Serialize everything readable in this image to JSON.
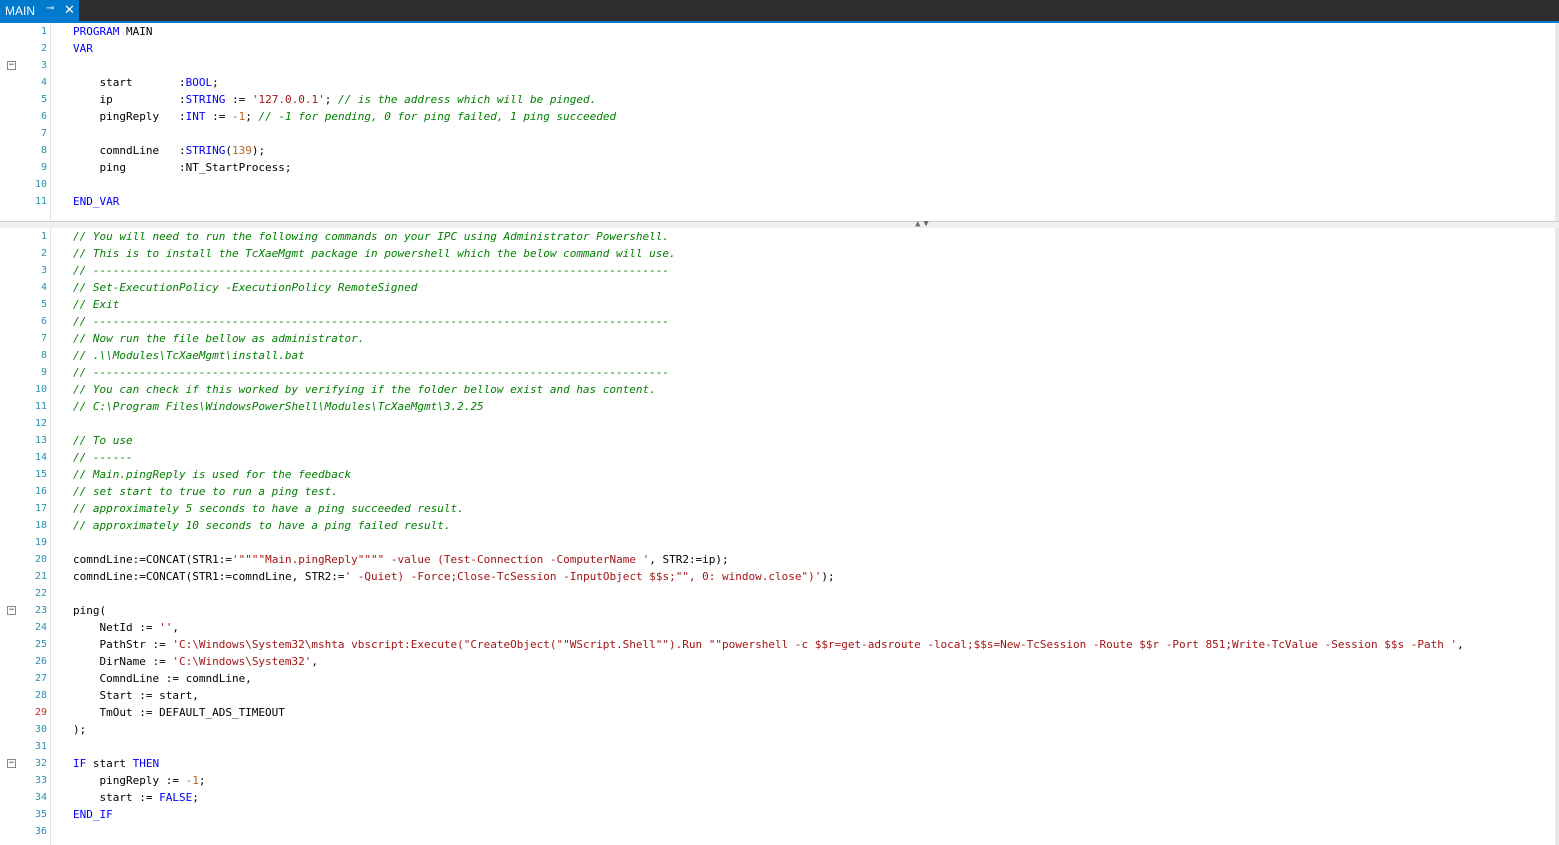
{
  "tab": {
    "title": "MAIN",
    "pin_icon": "⊸",
    "close_icon": "✕"
  },
  "colors": {
    "tab_active": "#007acc",
    "tab_bar": "#2d2d30",
    "keyword": "#0000ff",
    "string": "#a31515",
    "comment": "#008000",
    "line_number": "#2b91af",
    "breakpoint_line": "#c42b1c"
  },
  "declaration_pane": {
    "fold_icon": "⊟",
    "lines": [
      {
        "no": "1",
        "text": "PROGRAM MAIN"
      },
      {
        "no": "2",
        "text": "VAR"
      },
      {
        "no": "3",
        "text": ""
      },
      {
        "no": "4",
        "text": "    start       :BOOL;"
      },
      {
        "no": "5",
        "text": "    ip          :STRING := '127.0.0.1'; // is the address which will be pinged."
      },
      {
        "no": "6",
        "text": "    pingReply   :INT := -1; // -1 for pending, 0 for ping failed, 1 ping succeeded"
      },
      {
        "no": "7",
        "text": ""
      },
      {
        "no": "8",
        "text": "    comndLine   :STRING(139);"
      },
      {
        "no": "9",
        "text": "    ping        :NT_StartProcess;"
      },
      {
        "no": "10",
        "text": ""
      },
      {
        "no": "11",
        "text": "END_VAR"
      }
    ]
  },
  "splitter_icon": "▲▼",
  "code_pane": {
    "fold_icon": "⊟",
    "lines": [
      {
        "no": "1",
        "text": "// You will need to run the following commands on your IPC using Administrator Powershell."
      },
      {
        "no": "2",
        "text": "// This is to install the TcXaeMgmt package in powershell which the below command will use."
      },
      {
        "no": "3",
        "text": "// ---------------------------------------------------------------------------------------"
      },
      {
        "no": "4",
        "text": "// Set-ExecutionPolicy -ExecutionPolicy RemoteSigned"
      },
      {
        "no": "5",
        "text": "// Exit"
      },
      {
        "no": "6",
        "text": "// ---------------------------------------------------------------------------------------"
      },
      {
        "no": "7",
        "text": "// Now run the file bellow as administrator."
      },
      {
        "no": "8",
        "text": "// .\\\\Modules\\TcXaeMgmt\\install.bat"
      },
      {
        "no": "9",
        "text": "// ---------------------------------------------------------------------------------------"
      },
      {
        "no": "10",
        "text": "// You can check if this worked by verifying if the folder bellow exist and has content."
      },
      {
        "no": "11",
        "text": "// C:\\Program Files\\WindowsPowerShell\\Modules\\TcXaeMgmt\\3.2.25"
      },
      {
        "no": "12",
        "text": ""
      },
      {
        "no": "13",
        "text": "// To use"
      },
      {
        "no": "14",
        "text": "// ------"
      },
      {
        "no": "15",
        "text": "// Main.pingReply is used for the feedback"
      },
      {
        "no": "16",
        "text": "// set start to true to run a ping test."
      },
      {
        "no": "17",
        "text": "// approximately 5 seconds to have a ping succeeded result."
      },
      {
        "no": "18",
        "text": "// approximately 10 seconds to have a ping failed result."
      },
      {
        "no": "19",
        "text": ""
      },
      {
        "no": "20",
        "text": "comndLine:=CONCAT(STR1:='\"\"\"\"Main.pingReply\"\"\"\" -value (Test-Connection -ComputerName ', STR2:=ip);"
      },
      {
        "no": "21",
        "text": "comndLine:=CONCAT(STR1:=comndLine, STR2:=' -Quiet) -Force;Close-TcSession -InputObject $$s;\"\", 0: window.close\")');"
      },
      {
        "no": "22",
        "text": ""
      },
      {
        "no": "23",
        "text": "ping("
      },
      {
        "no": "24",
        "text": "    NetId := '',"
      },
      {
        "no": "25",
        "text": "    PathStr := 'C:\\Windows\\System32\\mshta vbscript:Execute(\"CreateObject(\"\"WScript.Shell\"\").Run \"\"powershell -c $$r=get-adsroute -local;$$s=New-TcSession -Route $$r -Port 851;Write-TcValue -Session $$s -Path ',"
      },
      {
        "no": "26",
        "text": "    DirName := 'C:\\Windows\\System32',"
      },
      {
        "no": "27",
        "text": "    ComndLine := comndLine,"
      },
      {
        "no": "28",
        "text": "    Start := start,"
      },
      {
        "no": "29",
        "text": "    TmOut := DEFAULT_ADS_TIMEOUT"
      },
      {
        "no": "30",
        "text": ");"
      },
      {
        "no": "31",
        "text": ""
      },
      {
        "no": "32",
        "text": "IF start THEN"
      },
      {
        "no": "33",
        "text": "    pingReply := -1;"
      },
      {
        "no": "34",
        "text": "    start := FALSE;"
      },
      {
        "no": "35",
        "text": "END_IF"
      },
      {
        "no": "36",
        "text": ""
      }
    ]
  }
}
